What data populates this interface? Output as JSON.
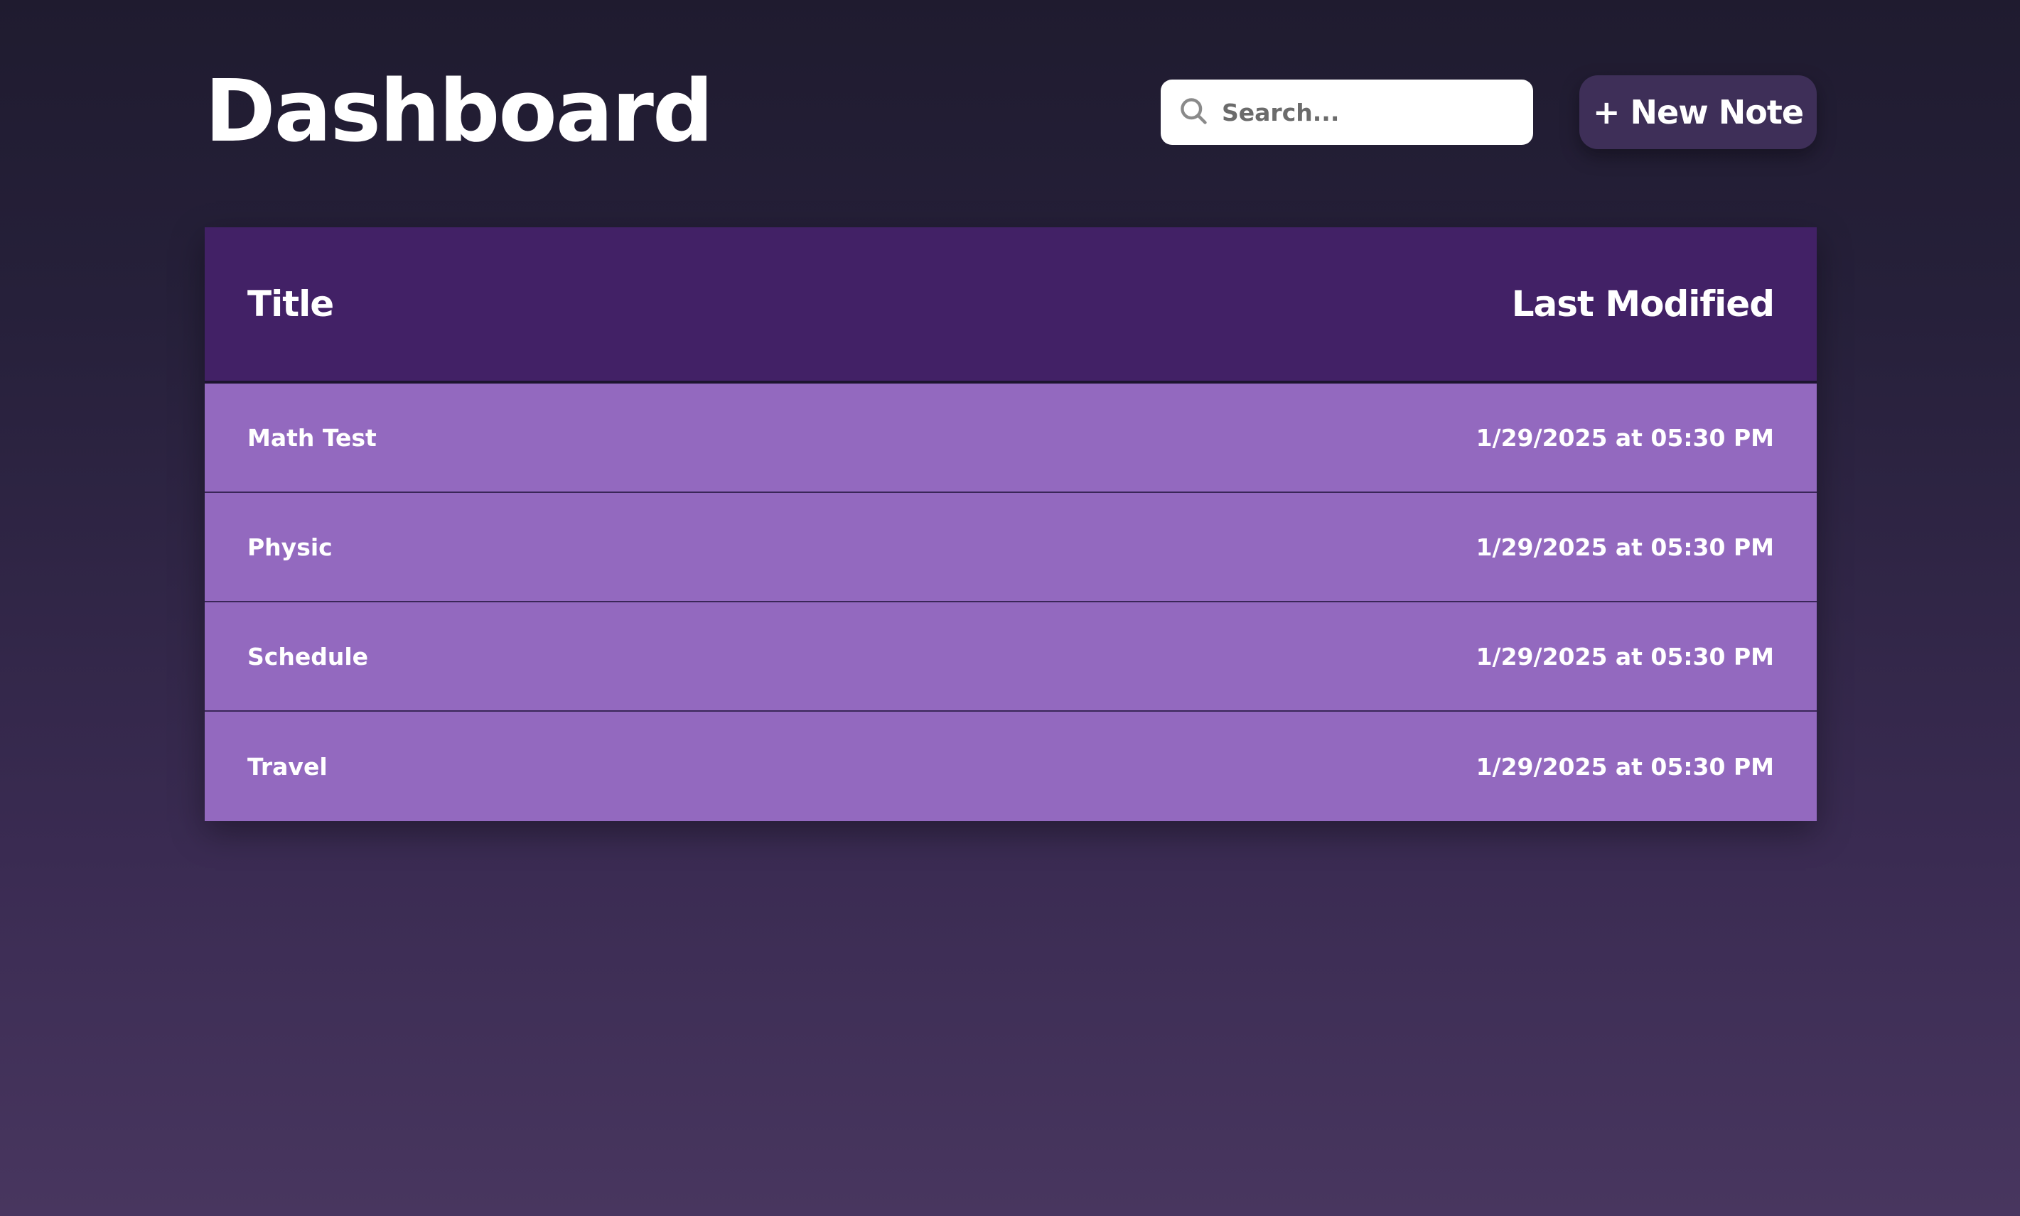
{
  "header": {
    "title": "Dashboard",
    "search_placeholder": "Search...",
    "new_note_label": "+ New Note"
  },
  "table": {
    "columns": {
      "title": "Title",
      "last_modified": "Last Modified"
    },
    "rows": [
      {
        "title": "Math Test",
        "modified": "1/29/2025 at 05:30 PM"
      },
      {
        "title": "Physic",
        "modified": "1/29/2025 at 05:30 PM"
      },
      {
        "title": "Schedule",
        "modified": "1/29/2025 at 05:30 PM"
      },
      {
        "title": "Travel",
        "modified": "1/29/2025 at 05:30 PM"
      }
    ]
  },
  "icons": {
    "search": "search-icon"
  },
  "colors": {
    "background_top": "#1f1b2f",
    "background_bottom": "#48365f",
    "table_header": "#422166",
    "table_row": "#9369bf",
    "button": "#3e2f58"
  }
}
